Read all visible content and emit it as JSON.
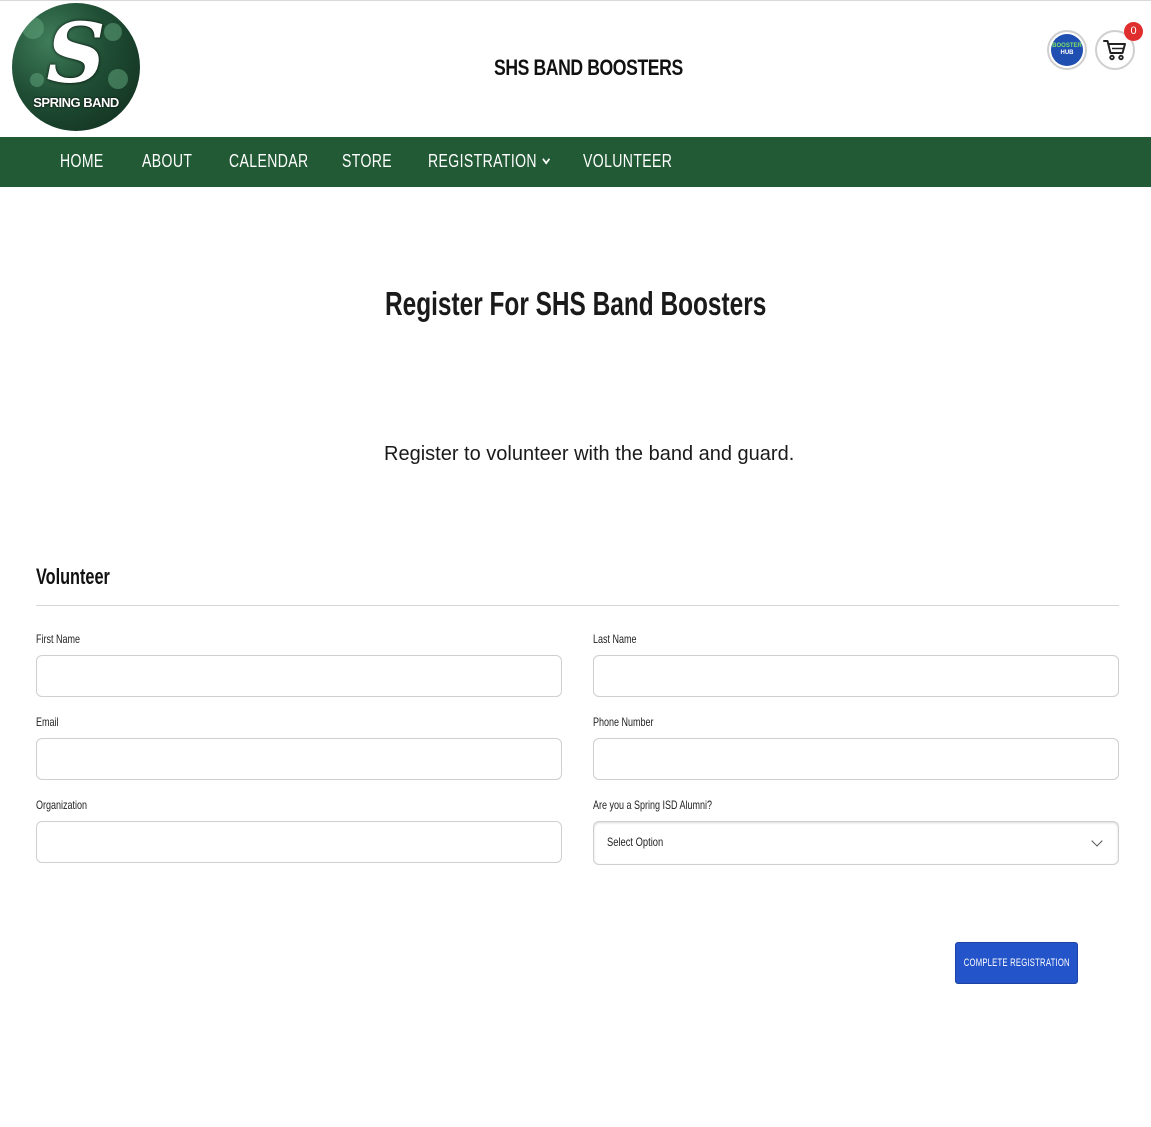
{
  "header": {
    "logo_text": "SPRING BAND",
    "logo_mark": "S",
    "site_title": "SHS BAND BOOSTERS",
    "hub_badge": {
      "line1": "BOOSTER",
      "line2": "HUB"
    },
    "cart_count": "0"
  },
  "nav": {
    "items": [
      {
        "label": "HOME"
      },
      {
        "label": "ABOUT"
      },
      {
        "label": "CALENDAR"
      },
      {
        "label": "STORE"
      },
      {
        "label": "REGISTRATION"
      },
      {
        "label": "VOLUNTEER"
      }
    ]
  },
  "main": {
    "heading": "Register For SHS Band Boosters",
    "intro": "Register to volunteer with the band and guard.",
    "section_title": "Volunteer",
    "fields": {
      "first_name": {
        "label": "First Name",
        "value": ""
      },
      "last_name": {
        "label": "Last Name",
        "value": ""
      },
      "email": {
        "label": "Email",
        "value": ""
      },
      "phone": {
        "label": "Phone Number",
        "value": ""
      },
      "organization": {
        "label": "Organization",
        "value": ""
      },
      "alumni": {
        "label": "Are you a Spring ISD Alumni?",
        "value": "Select Option"
      }
    },
    "submit_label": "COMPLETE REGISTRATION"
  },
  "colors": {
    "nav_bg": "#215a34",
    "submit_bg": "#2454c9",
    "badge": "#e02d2d"
  }
}
